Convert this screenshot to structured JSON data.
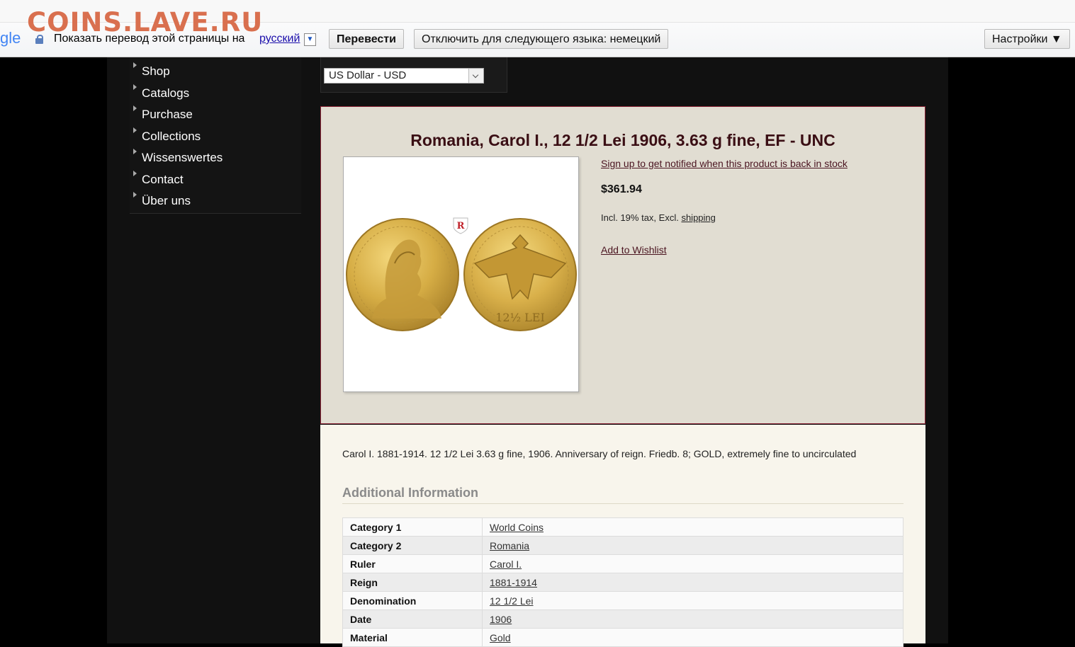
{
  "watermark": "COINS.LAVE.RU",
  "translate_bar": {
    "logo_fragment": "gle",
    "prompt": "Показать перевод этой страницы на",
    "language": "русский",
    "translate_button": "Перевести",
    "disable_button": "Отключить для следующего языка: немецкий",
    "settings_button": "Настройки ▼"
  },
  "sidebar": {
    "items": [
      {
        "label": "Shop"
      },
      {
        "label": "Catalogs"
      },
      {
        "label": "Purchase"
      },
      {
        "label": "Collections"
      },
      {
        "label": "Wissenswertes"
      },
      {
        "label": "Contact"
      },
      {
        "label": "Über uns"
      }
    ]
  },
  "currency": {
    "selected": "US Dollar - USD"
  },
  "product": {
    "title": "Romania, Carol I., 12 1/2 Lei 1906, 3.63 g fine, EF - UNC",
    "notify_link": "Sign up to get notified when this product is back in stock",
    "price": "$361.94",
    "tax_text": "Incl. 19% tax, Excl.",
    "shipping_link": "shipping",
    "wishlist_link": "Add to Wishlist",
    "badge_letter": "R",
    "coin_denomination_text": "12½ LEI",
    "description": "Carol I. 1881-1914. 12 1/2 Lei 3.63 g fine, 1906. Anniversary of reign. Friedb. 8; GOLD, extremely fine to uncirculated"
  },
  "additional_info": {
    "heading": "Additional Information",
    "rows": [
      {
        "key": "Category 1",
        "value": "World Coins"
      },
      {
        "key": "Category 2",
        "value": "Romania"
      },
      {
        "key": "Ruler",
        "value": "Carol I."
      },
      {
        "key": "Reign",
        "value": "1881-1914"
      },
      {
        "key": "Denomination",
        "value": "12 1/2 Lei"
      },
      {
        "key": "Date",
        "value": "1906"
      },
      {
        "key": "Material",
        "value": "Gold"
      }
    ]
  },
  "colors": {
    "accent_border": "#8a2335",
    "title_color": "#3a0e14",
    "watermark_color": "#d9704f"
  }
}
